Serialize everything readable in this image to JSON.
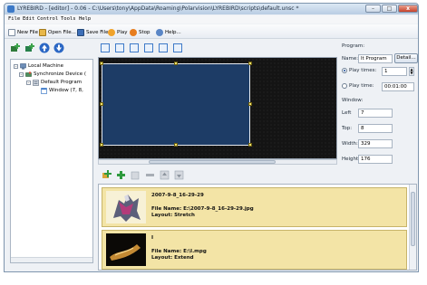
{
  "window": {
    "title": "LYREBIRD - [editor] - 0.06 - C:\\Users\\tony\\AppData\\Roaming\\Polarvision\\LYREBIRD\\scripts\\default.unsc *",
    "minimize": "–",
    "maximize": "□",
    "close": "x"
  },
  "menu": {
    "items": [
      "File",
      "Edit",
      "Control",
      "Tools",
      "Help"
    ]
  },
  "toolbar": {
    "new_file": "New File",
    "open_file": "Open File...",
    "save_file": "Save File",
    "play": "Play",
    "stop": "Stop",
    "help": "Help..."
  },
  "tree": {
    "nodes": [
      {
        "label": "Local Machine",
        "toggle": "–"
      },
      {
        "label": "Synchronize Device (",
        "toggle": "–"
      },
      {
        "label": "Default Program",
        "toggle": "–"
      },
      {
        "label": "Window (7, 8,"
      }
    ]
  },
  "properties": {
    "group_program": "Program:",
    "name_label": "Name:",
    "name_value": "lt Program",
    "detail_button": "Detail...",
    "play_times_label": "Play times:",
    "play_times_value": "1",
    "play_time_label": "Play time:",
    "play_time_value": "00:01:00",
    "group_window": "Window:",
    "left_label": "Left",
    "left_value": "7",
    "top_label": "Top:",
    "top_value": "8",
    "width_label": "Width:",
    "width_value": "329",
    "height_label": "Height:",
    "height_value": "176"
  },
  "library": {
    "items": [
      {
        "title": "2007-9-8_16-29-29",
        "file_name": "File Name: E:\\2007-9-8_16-29-29.jpg",
        "layout": "Layout: Stretch"
      },
      {
        "title": "I",
        "file_name": "File Name: E:\\I.mpg",
        "layout": "Layout: Extend"
      }
    ]
  },
  "colors": {
    "accent": "#3e7ac8",
    "stage_bg": "#141414",
    "window_rect": "#1d3c66",
    "handle": "#f5e46a",
    "item_bg": "#f3e4a6"
  }
}
